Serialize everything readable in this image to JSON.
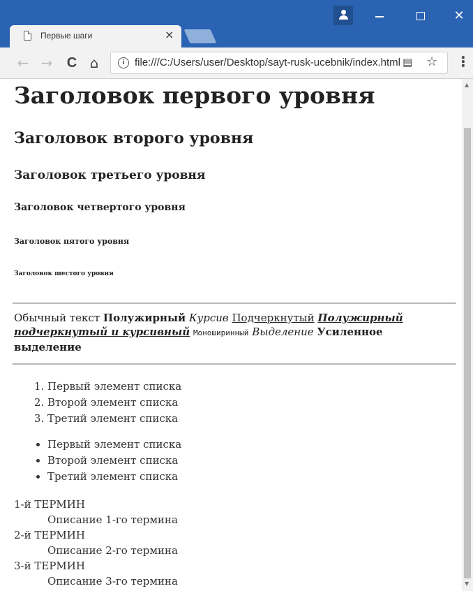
{
  "browser": {
    "tab_title": "Первые шаги",
    "tab_close": "×",
    "url": "file:///C:/Users/user/Desktop/sayt-rusk-ucebnik/index.html",
    "window_controls": {
      "minimize": "—",
      "maximize": "☐",
      "close": "✕"
    },
    "nav": {
      "back": "←",
      "forward": "→",
      "reload": "C",
      "home": "⌂"
    }
  },
  "page": {
    "h1": "Заголовок первого уровня",
    "h2": "Заголовок второго уровня",
    "h3": "Заголовок третьего уровня",
    "h4": "Заголовок четвертого уровня",
    "h5": "Заголовок пятого уровня",
    "h6": "Заголовок шестого уровня",
    "rich_text": {
      "normal": "Обычный текст",
      "bold": "Полужирный",
      "italic": "Курсив",
      "underline": "Подчеркнутый",
      "bold_underline_italic": "Полужирный подчеркнутый и курсивный",
      "monospace": "Моноширинный",
      "emphasis": "Выделение",
      "strong": "Усиленное выделение"
    },
    "ordered_list": [
      "Первый элемент списка",
      "Второй элемент списка",
      "Третий элемент списка"
    ],
    "unordered_list": [
      "Первый элемент списка",
      "Второй элемент списка",
      "Третий элемент списка"
    ],
    "definitions": [
      {
        "term": "1-й ТЕРМИН",
        "description": "Описание 1-го термина"
      },
      {
        "term": "2-й ТЕРМИН",
        "description": "Описание 2-го термина"
      },
      {
        "term": "3-й ТЕРМИН",
        "description": "Описание 3-го термина"
      }
    ]
  },
  "colors": {
    "titlebar": "#2b63b3",
    "toolbar": "#f2f2f2"
  }
}
